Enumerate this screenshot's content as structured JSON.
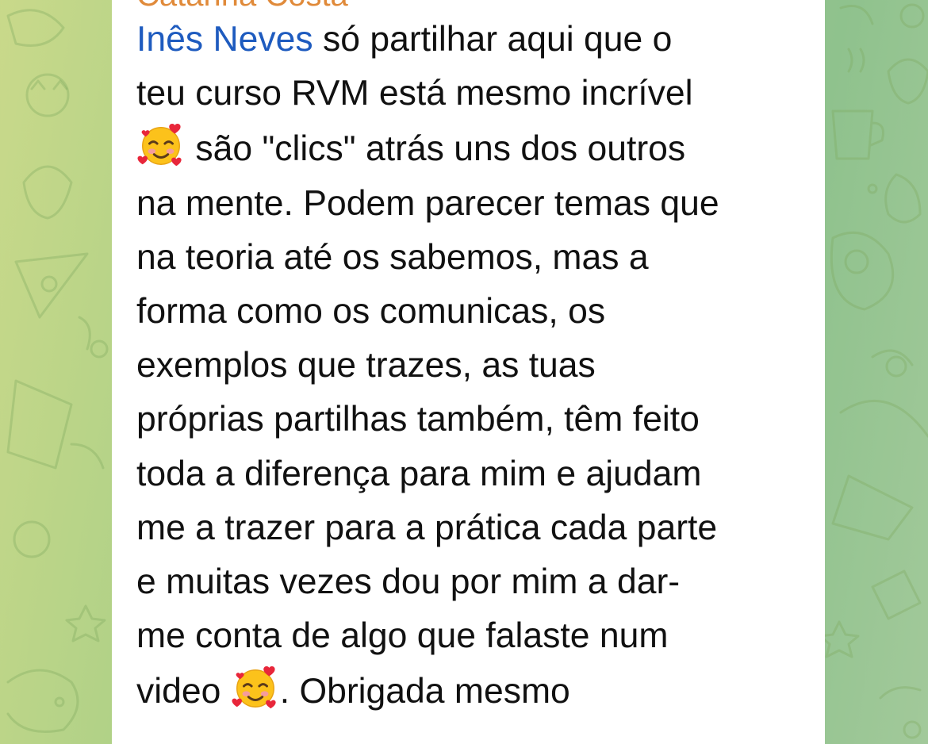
{
  "sender_name": "Catarina Costa",
  "message": {
    "mention": "Inês Neves",
    "line_1_rest": " só partilhar aqui que o",
    "line_2": "teu curso RVM está mesmo incrível",
    "line_3_rest": " são \"clics\" atrás uns dos outros",
    "line_4": "na mente. Podem parecer temas que",
    "line_5": "na teoria até os sabemos, mas a",
    "line_6": "forma como os comunicas, os",
    "line_7": "exemplos que trazes, as tuas",
    "line_8": "próprias partilhas também, têm feito",
    "line_9": "toda a diferença para mim e ajudam",
    "line_10": "me a trazer para a prática cada parte",
    "line_11": "e muitas vezes dou por mim a dar-",
    "line_12": "me conta de algo que falaste num",
    "line_13_start": "video ",
    "line_13_end": ". Obrigada mesmo"
  },
  "icons": {
    "emoji": "smiling-face-with-hearts-emoji"
  },
  "colors": {
    "sender": "#e08a3a",
    "mention": "#1e5bbf",
    "text": "#111111",
    "bubble": "#ffffff"
  }
}
